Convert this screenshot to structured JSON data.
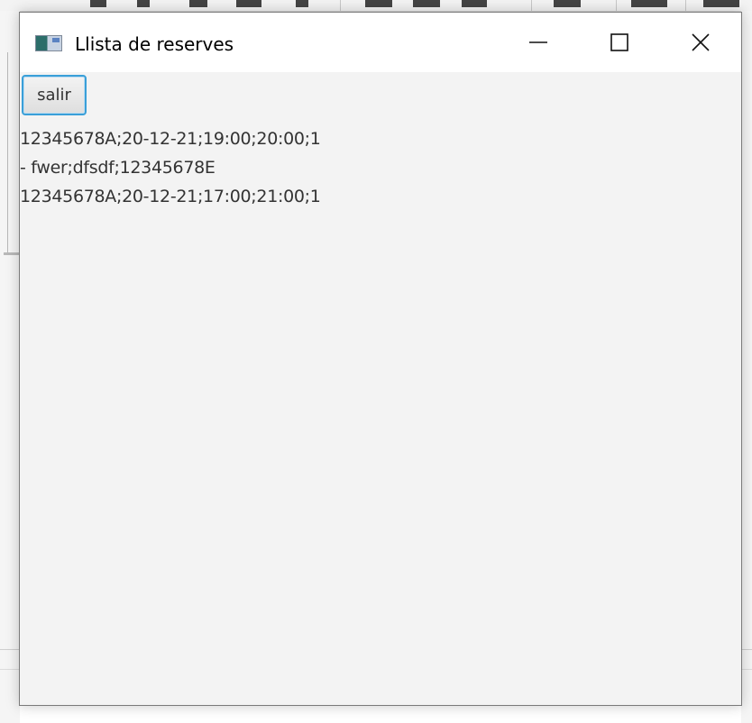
{
  "window": {
    "title": "Llista de reserves",
    "controls": {
      "minimize": "minimize-icon",
      "maximize": "maximize-icon",
      "close": "close-icon"
    }
  },
  "content": {
    "exit_button_label": "salir",
    "lines": [
      "12345678A;20-12-21;19:00;20:00;1",
      "- fwer;dfsdf;12345678E",
      "12345678A;20-12-21;17:00;21:00;1"
    ]
  },
  "colors": {
    "accent": "#3a9fd8",
    "window_background": "#f3f3f3",
    "titlebar_background": "#ffffff",
    "text": "#333333"
  }
}
